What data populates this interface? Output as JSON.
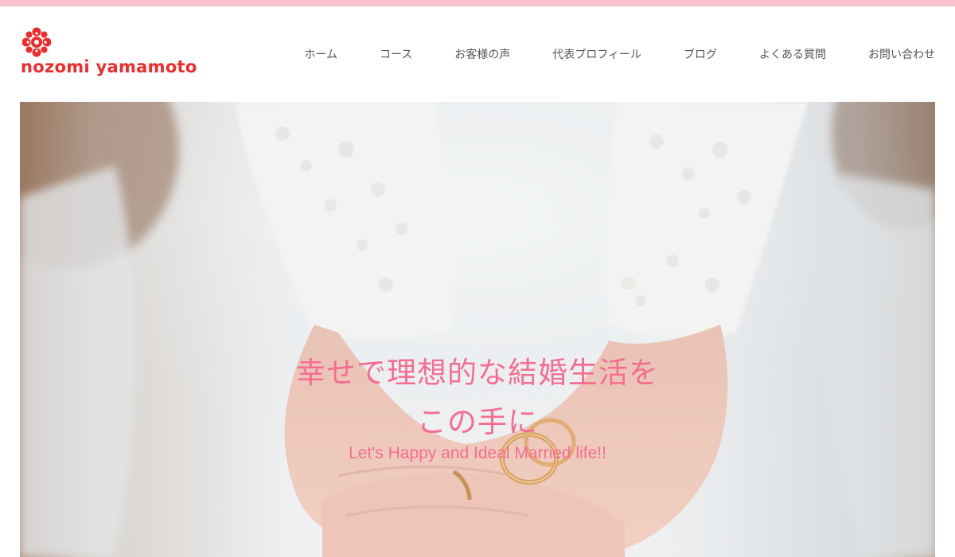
{
  "colors": {
    "top_stripe": "#f7c4ce",
    "brand_red": "#ee2a2a",
    "accent_pink": "#f56d91",
    "nav_text": "#555555"
  },
  "logo": {
    "text": "nozomi yamamoto",
    "icon": "flower-icon"
  },
  "nav": {
    "items": [
      {
        "label": "ホーム"
      },
      {
        "label": "コース"
      },
      {
        "label": "お客様の声"
      },
      {
        "label": "代表プロフィール"
      },
      {
        "label": "ブログ"
      },
      {
        "label": "よくある質問"
      },
      {
        "label": "お問い合わせ"
      }
    ]
  },
  "hero": {
    "image": "hands-holding-wedding-rings-photo",
    "headline_line1": "幸せで理想的な結婚生活を",
    "headline_line2": "この手に",
    "subheadline": "Let's Happy and Ideal Married life!!"
  }
}
